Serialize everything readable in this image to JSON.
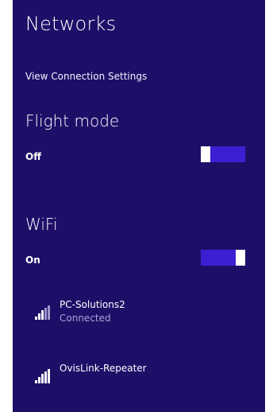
{
  "panel": {
    "title": "Networks",
    "view_settings_link": "View Connection Settings"
  },
  "flight_mode": {
    "label": "Flight mode",
    "state": "Off",
    "on": false
  },
  "wifi": {
    "label": "WiFi",
    "state": "On",
    "on": true
  },
  "networks": [
    {
      "name": "PC-Solutions2",
      "status": "Connected",
      "icon": "wifi-signal-icon"
    },
    {
      "name": "OvisLink-Repeater",
      "status": "",
      "icon": "wifi-signal-icon"
    }
  ],
  "colors": {
    "panel_background": "#1f0e68",
    "toggle_track": "#3b1fd2",
    "toggle_thumb": "#ffffff",
    "secondary_text": "#a9a3d8"
  }
}
